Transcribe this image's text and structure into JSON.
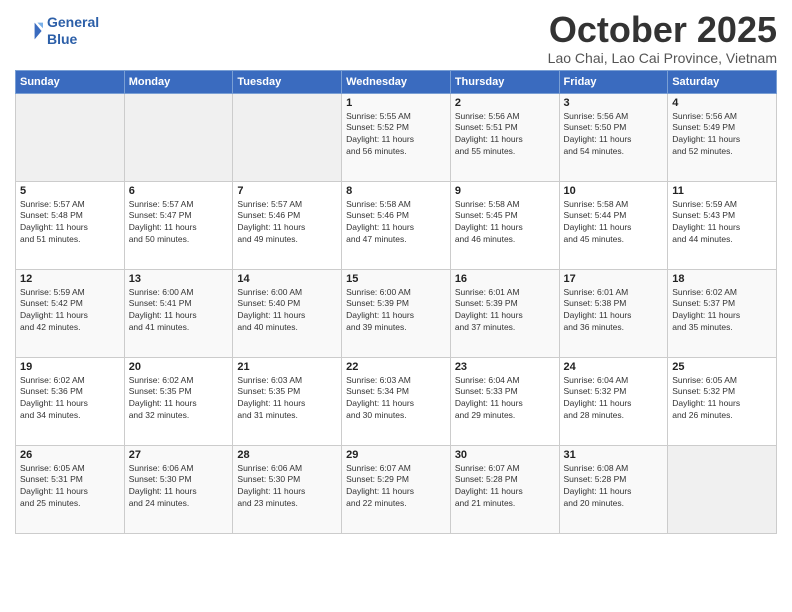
{
  "logo": {
    "line1": "General",
    "line2": "Blue"
  },
  "title": "October 2025",
  "subtitle": "Lao Chai, Lao Cai Province, Vietnam",
  "days_of_week": [
    "Sunday",
    "Monday",
    "Tuesday",
    "Wednesday",
    "Thursday",
    "Friday",
    "Saturday"
  ],
  "weeks": [
    [
      {
        "day": "",
        "info": ""
      },
      {
        "day": "",
        "info": ""
      },
      {
        "day": "",
        "info": ""
      },
      {
        "day": "1",
        "info": "Sunrise: 5:55 AM\nSunset: 5:52 PM\nDaylight: 11 hours\nand 56 minutes."
      },
      {
        "day": "2",
        "info": "Sunrise: 5:56 AM\nSunset: 5:51 PM\nDaylight: 11 hours\nand 55 minutes."
      },
      {
        "day": "3",
        "info": "Sunrise: 5:56 AM\nSunset: 5:50 PM\nDaylight: 11 hours\nand 54 minutes."
      },
      {
        "day": "4",
        "info": "Sunrise: 5:56 AM\nSunset: 5:49 PM\nDaylight: 11 hours\nand 52 minutes."
      }
    ],
    [
      {
        "day": "5",
        "info": "Sunrise: 5:57 AM\nSunset: 5:48 PM\nDaylight: 11 hours\nand 51 minutes."
      },
      {
        "day": "6",
        "info": "Sunrise: 5:57 AM\nSunset: 5:47 PM\nDaylight: 11 hours\nand 50 minutes."
      },
      {
        "day": "7",
        "info": "Sunrise: 5:57 AM\nSunset: 5:46 PM\nDaylight: 11 hours\nand 49 minutes."
      },
      {
        "day": "8",
        "info": "Sunrise: 5:58 AM\nSunset: 5:46 PM\nDaylight: 11 hours\nand 47 minutes."
      },
      {
        "day": "9",
        "info": "Sunrise: 5:58 AM\nSunset: 5:45 PM\nDaylight: 11 hours\nand 46 minutes."
      },
      {
        "day": "10",
        "info": "Sunrise: 5:58 AM\nSunset: 5:44 PM\nDaylight: 11 hours\nand 45 minutes."
      },
      {
        "day": "11",
        "info": "Sunrise: 5:59 AM\nSunset: 5:43 PM\nDaylight: 11 hours\nand 44 minutes."
      }
    ],
    [
      {
        "day": "12",
        "info": "Sunrise: 5:59 AM\nSunset: 5:42 PM\nDaylight: 11 hours\nand 42 minutes."
      },
      {
        "day": "13",
        "info": "Sunrise: 6:00 AM\nSunset: 5:41 PM\nDaylight: 11 hours\nand 41 minutes."
      },
      {
        "day": "14",
        "info": "Sunrise: 6:00 AM\nSunset: 5:40 PM\nDaylight: 11 hours\nand 40 minutes."
      },
      {
        "day": "15",
        "info": "Sunrise: 6:00 AM\nSunset: 5:39 PM\nDaylight: 11 hours\nand 39 minutes."
      },
      {
        "day": "16",
        "info": "Sunrise: 6:01 AM\nSunset: 5:39 PM\nDaylight: 11 hours\nand 37 minutes."
      },
      {
        "day": "17",
        "info": "Sunrise: 6:01 AM\nSunset: 5:38 PM\nDaylight: 11 hours\nand 36 minutes."
      },
      {
        "day": "18",
        "info": "Sunrise: 6:02 AM\nSunset: 5:37 PM\nDaylight: 11 hours\nand 35 minutes."
      }
    ],
    [
      {
        "day": "19",
        "info": "Sunrise: 6:02 AM\nSunset: 5:36 PM\nDaylight: 11 hours\nand 34 minutes."
      },
      {
        "day": "20",
        "info": "Sunrise: 6:02 AM\nSunset: 5:35 PM\nDaylight: 11 hours\nand 32 minutes."
      },
      {
        "day": "21",
        "info": "Sunrise: 6:03 AM\nSunset: 5:35 PM\nDaylight: 11 hours\nand 31 minutes."
      },
      {
        "day": "22",
        "info": "Sunrise: 6:03 AM\nSunset: 5:34 PM\nDaylight: 11 hours\nand 30 minutes."
      },
      {
        "day": "23",
        "info": "Sunrise: 6:04 AM\nSunset: 5:33 PM\nDaylight: 11 hours\nand 29 minutes."
      },
      {
        "day": "24",
        "info": "Sunrise: 6:04 AM\nSunset: 5:32 PM\nDaylight: 11 hours\nand 28 minutes."
      },
      {
        "day": "25",
        "info": "Sunrise: 6:05 AM\nSunset: 5:32 PM\nDaylight: 11 hours\nand 26 minutes."
      }
    ],
    [
      {
        "day": "26",
        "info": "Sunrise: 6:05 AM\nSunset: 5:31 PM\nDaylight: 11 hours\nand 25 minutes."
      },
      {
        "day": "27",
        "info": "Sunrise: 6:06 AM\nSunset: 5:30 PM\nDaylight: 11 hours\nand 24 minutes."
      },
      {
        "day": "28",
        "info": "Sunrise: 6:06 AM\nSunset: 5:30 PM\nDaylight: 11 hours\nand 23 minutes."
      },
      {
        "day": "29",
        "info": "Sunrise: 6:07 AM\nSunset: 5:29 PM\nDaylight: 11 hours\nand 22 minutes."
      },
      {
        "day": "30",
        "info": "Sunrise: 6:07 AM\nSunset: 5:28 PM\nDaylight: 11 hours\nand 21 minutes."
      },
      {
        "day": "31",
        "info": "Sunrise: 6:08 AM\nSunset: 5:28 PM\nDaylight: 11 hours\nand 20 minutes."
      },
      {
        "day": "",
        "info": ""
      }
    ]
  ]
}
